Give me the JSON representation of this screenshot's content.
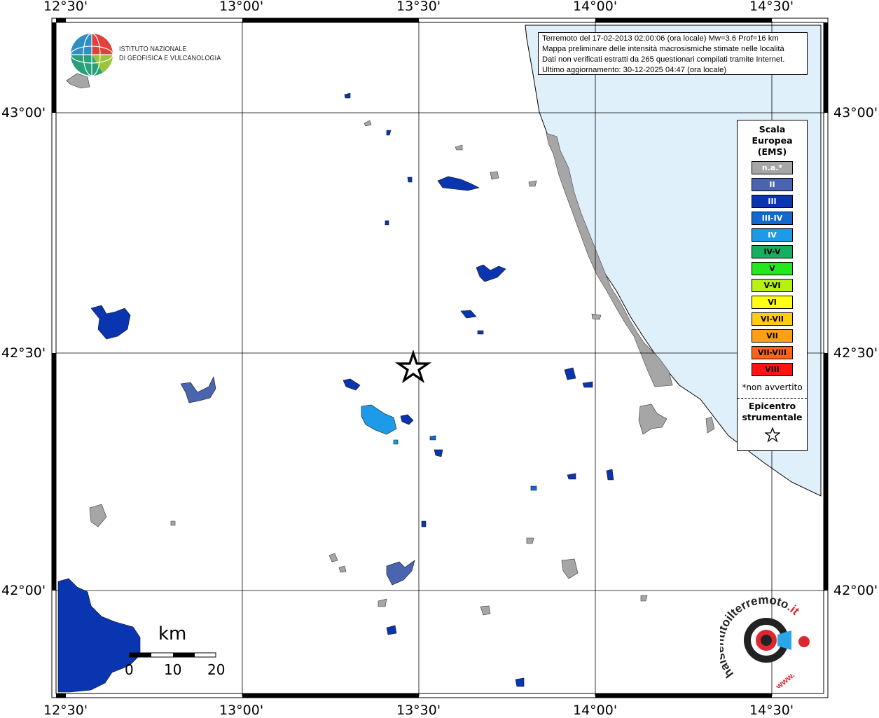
{
  "map": {
    "lon_labels": [
      "12°30'",
      "13°00'",
      "13°30'",
      "14°00'",
      "14°30'"
    ],
    "lat_labels": [
      "43°00'",
      "42°30'",
      "42°00'"
    ],
    "grid": true,
    "sea_color": "#dff0fb",
    "epicenter_icon": "star-icon"
  },
  "header": {
    "institute_line1": "ISTITUTO NAZIONALE",
    "institute_line2": "DI GEOFISICA E VULCANOLOGIA"
  },
  "info": {
    "line1": "Terremoto del 17-02-2013 02:00:06 (ora locale) Mw=3.6 Prof=16 km",
    "line2": "Mappa preliminare delle intensità macrosismiche stimate nelle località",
    "line3": "Dati non verificati estratti da 265 questionari compilati tramite Internet.",
    "line4": "Ultimo aggiornamento: 30-12-2025 04:47 (ora locale)"
  },
  "legend": {
    "title_line1": "Scala",
    "title_line2": "Europea",
    "title_line3": "(EMS)",
    "items": [
      {
        "label": "n.a.*",
        "color": "#a6a6a6",
        "text_color": "#ffffff"
      },
      {
        "label": "II",
        "color": "#4a64b0",
        "text_color": "#ffffff"
      },
      {
        "label": "III",
        "color": "#0a35b0",
        "text_color": "#ffffff"
      },
      {
        "label": "III-IV",
        "color": "#1469d0",
        "text_color": "#ffffff"
      },
      {
        "label": "IV",
        "color": "#1e9be8",
        "text_color": "#ffffff"
      },
      {
        "label": "IV-V",
        "color": "#12b060",
        "text_color": "#000000"
      },
      {
        "label": "V",
        "color": "#24e81e",
        "text_color": "#000000"
      },
      {
        "label": "V-VI",
        "color": "#b8f014",
        "text_color": "#000000"
      },
      {
        "label": "VI",
        "color": "#ffff14",
        "text_color": "#000000"
      },
      {
        "label": "VI-VII",
        "color": "#ffcc14",
        "text_color": "#000000"
      },
      {
        "label": "VII",
        "color": "#ffa014",
        "text_color": "#000000"
      },
      {
        "label": "VII-VIII",
        "color": "#ff6414",
        "text_color": "#000000"
      },
      {
        "label": "VIII",
        "color": "#ff1414",
        "text_color": "#000000"
      }
    ],
    "note": "*non avvertito",
    "epicenter_line1": "Epicentro",
    "epicenter_line2": "strumentale"
  },
  "scalebar": {
    "unit": "km",
    "ticks": [
      "0",
      "10",
      "20"
    ]
  },
  "watermark": {
    "text_main": "haisentitoilterremoto",
    "text_suffix": ".it",
    "text_www": "www."
  }
}
